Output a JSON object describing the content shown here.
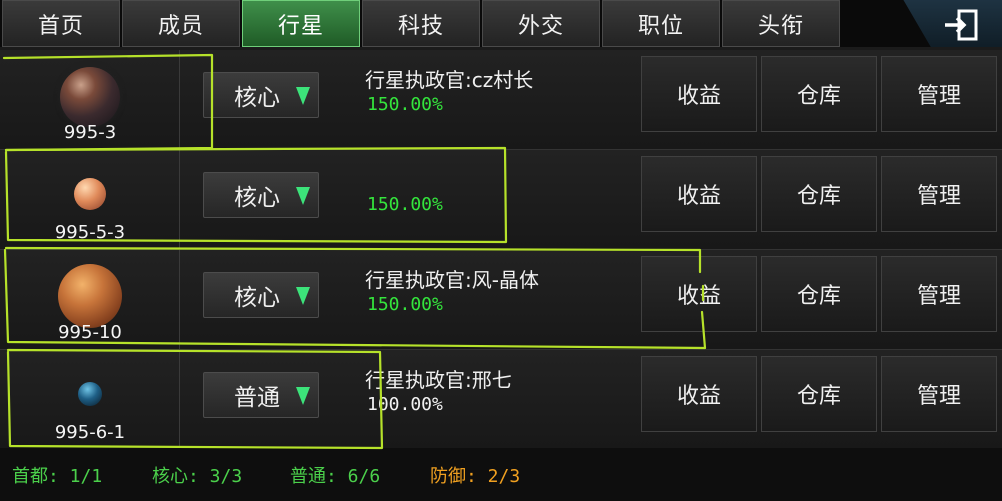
{
  "tabs": [
    {
      "label": "首页",
      "active": false
    },
    {
      "label": "成员",
      "active": false
    },
    {
      "label": "行星",
      "active": true
    },
    {
      "label": "科技",
      "active": false
    },
    {
      "label": "外交",
      "active": false
    },
    {
      "label": "职位",
      "active": false
    },
    {
      "label": "头衔",
      "active": false
    }
  ],
  "exit_icon": "exit-icon",
  "planets": [
    {
      "name": "995-3",
      "type": "核心",
      "governor": "行星执政官:cz村长",
      "bonus": "150.00%",
      "bonus_color": "#34e43c",
      "actions": [
        "收益",
        "仓库",
        "管理"
      ]
    },
    {
      "name": "995-5-3",
      "type": "核心",
      "governor": "",
      "bonus": "150.00%",
      "bonus_color": "#34e43c",
      "actions": [
        "收益",
        "仓库",
        "管理"
      ]
    },
    {
      "name": "995-10",
      "type": "核心",
      "governor": "行星执政官:风-晶体",
      "bonus": "150.00%",
      "bonus_color": "#34e43c",
      "actions": [
        "收益",
        "仓库",
        "管理"
      ]
    },
    {
      "name": "995-6-1",
      "type": "普通",
      "governor": "行星执政官:邢七",
      "bonus": "100.00%",
      "bonus_color": "#f2f2f2",
      "actions": [
        "收益",
        "仓库",
        "管理"
      ]
    }
  ],
  "footer": {
    "capital": "首都: 1/1",
    "core": "核心: 3/3",
    "normal": "普通: 6/6",
    "defense": "防御: 2/3"
  },
  "colors": {
    "accent_green": "#3f8f4a",
    "bonus_green": "#34e43c",
    "defense_orange": "#f0a020",
    "highlight": "#b6e22a"
  }
}
